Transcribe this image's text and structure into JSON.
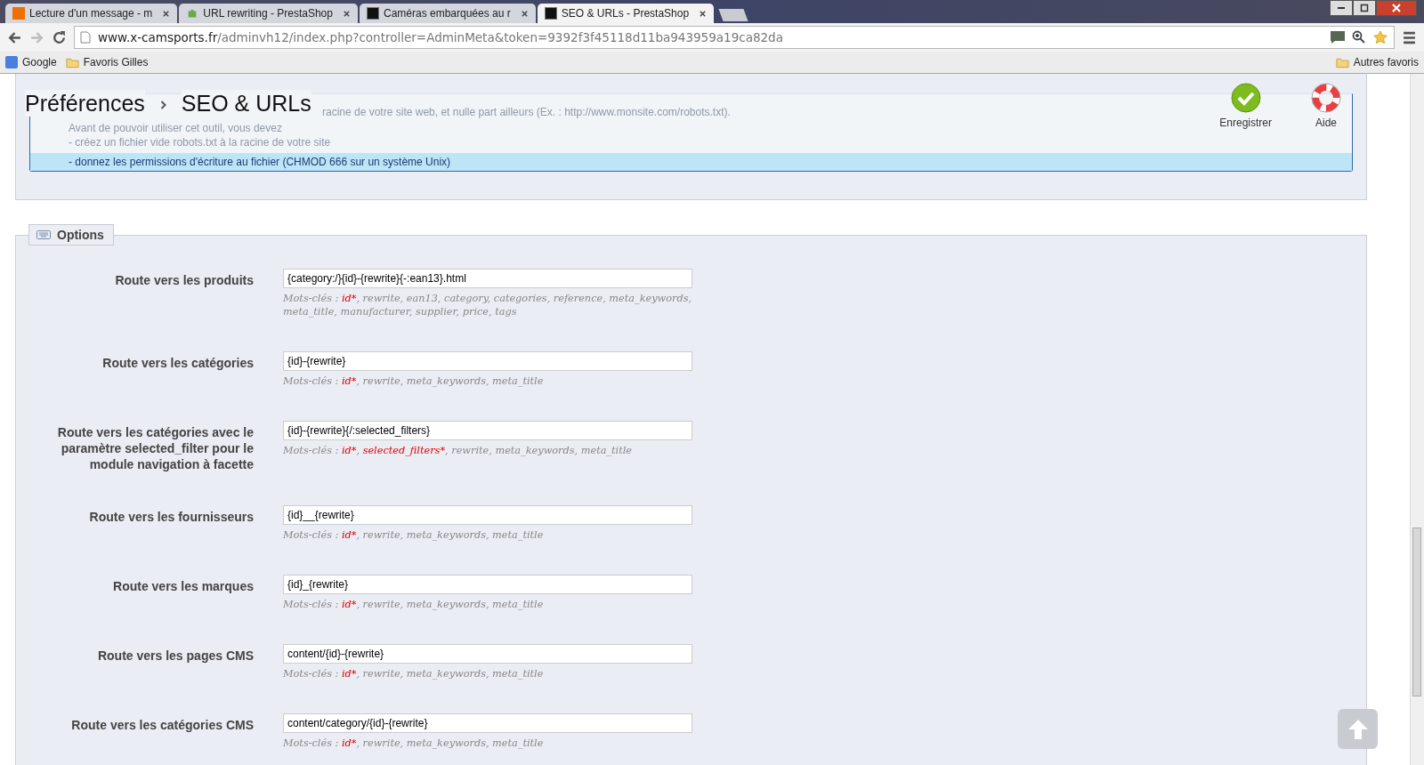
{
  "browser": {
    "tabs": [
      {
        "title": "Lecture d'un message - m",
        "selected": false
      },
      {
        "title": "URL rewriting - PrestaShop",
        "selected": false
      },
      {
        "title": "Caméras embarquées au r",
        "selected": false
      },
      {
        "title": "SEO & URLs - PrestaShop",
        "selected": true
      }
    ],
    "address": {
      "host": "www.x-camsports.fr",
      "path": "/adminvh12/index.php?controller=AdminMeta&token=9392f3f45118d11ba943959a19ca82da"
    },
    "bookmarks": [
      {
        "label": "Google",
        "kind": "google"
      },
      {
        "label": "Favoris Gilles",
        "kind": "folder"
      }
    ],
    "other_bookmarks": "Autres favoris"
  },
  "toolbar": {
    "breadcrumb": [
      "Préférences",
      "SEO & URLs"
    ],
    "actions": [
      {
        "label": "Enregistrer",
        "kind": "save"
      },
      {
        "label": "Aide",
        "kind": "help"
      }
    ]
  },
  "notice": {
    "faded_lines": [
      "racine de votre site web, et nulle part ailleurs (Ex. : http://www.monsite.com/robots.txt).",
      "Avant de pouvoir utiliser cet outil, vous devez",
      "- créez un fichier vide robots.txt à la racine de votre site"
    ],
    "line": "- donnez les permissions d'écriture au fichier (CHMOD 666 sur un système Unix)"
  },
  "options": {
    "title": "Options",
    "fields": [
      {
        "label": "Route vers les produits",
        "value": "{category:/}{id}-{rewrite}{-:ean13}.html",
        "keywords_prefix": "Mots-clés :",
        "keywords": [
          {
            "text": "id*",
            "required": true
          },
          {
            "text": ", rewrite, ean13, category, categories, reference, meta_keywords, meta_title, manufacturer, supplier, price, tags",
            "required": false
          }
        ]
      },
      {
        "label": "Route vers les catégories",
        "value": "{id}-{rewrite}",
        "keywords_prefix": "Mots-clés :",
        "keywords": [
          {
            "text": "id*",
            "required": true
          },
          {
            "text": ", rewrite, meta_keywords, meta_title",
            "required": false
          }
        ]
      },
      {
        "label": "Route vers les catégories avec le paramètre selected_filter pour le module navigation à facette",
        "value": "{id}-{rewrite}{/:selected_filters}",
        "keywords_prefix": "Mots-clés :",
        "keywords": [
          {
            "text": "id*",
            "required": true
          },
          {
            "text": ", ",
            "required": false
          },
          {
            "text": "selected_filters*",
            "required": true
          },
          {
            "text": ", rewrite, meta_keywords, meta_title",
            "required": false
          }
        ]
      },
      {
        "label": "Route vers les fournisseurs",
        "value": "{id}__{rewrite}",
        "keywords_prefix": "Mots-clés :",
        "keywords": [
          {
            "text": "id*",
            "required": true
          },
          {
            "text": ", rewrite, meta_keywords, meta_title",
            "required": false
          }
        ]
      },
      {
        "label": "Route vers les marques",
        "value": "{id}_{rewrite}",
        "keywords_prefix": "Mots-clés :",
        "keywords": [
          {
            "text": "id*",
            "required": true
          },
          {
            "text": ", rewrite, meta_keywords, meta_title",
            "required": false
          }
        ]
      },
      {
        "label": "Route vers les pages CMS",
        "value": "content/{id}-{rewrite}",
        "keywords_prefix": "Mots-clés :",
        "keywords": [
          {
            "text": "id*",
            "required": true
          },
          {
            "text": ", rewrite, meta_keywords, meta_title",
            "required": false
          }
        ]
      },
      {
        "label": "Route vers les catégories CMS",
        "value": "content/category/{id}-{rewrite}",
        "keywords_prefix": "Mots-clés :",
        "keywords": [
          {
            "text": "id*",
            "required": true
          },
          {
            "text": ", rewrite, meta_keywords, meta_title",
            "required": false
          }
        ]
      }
    ]
  }
}
